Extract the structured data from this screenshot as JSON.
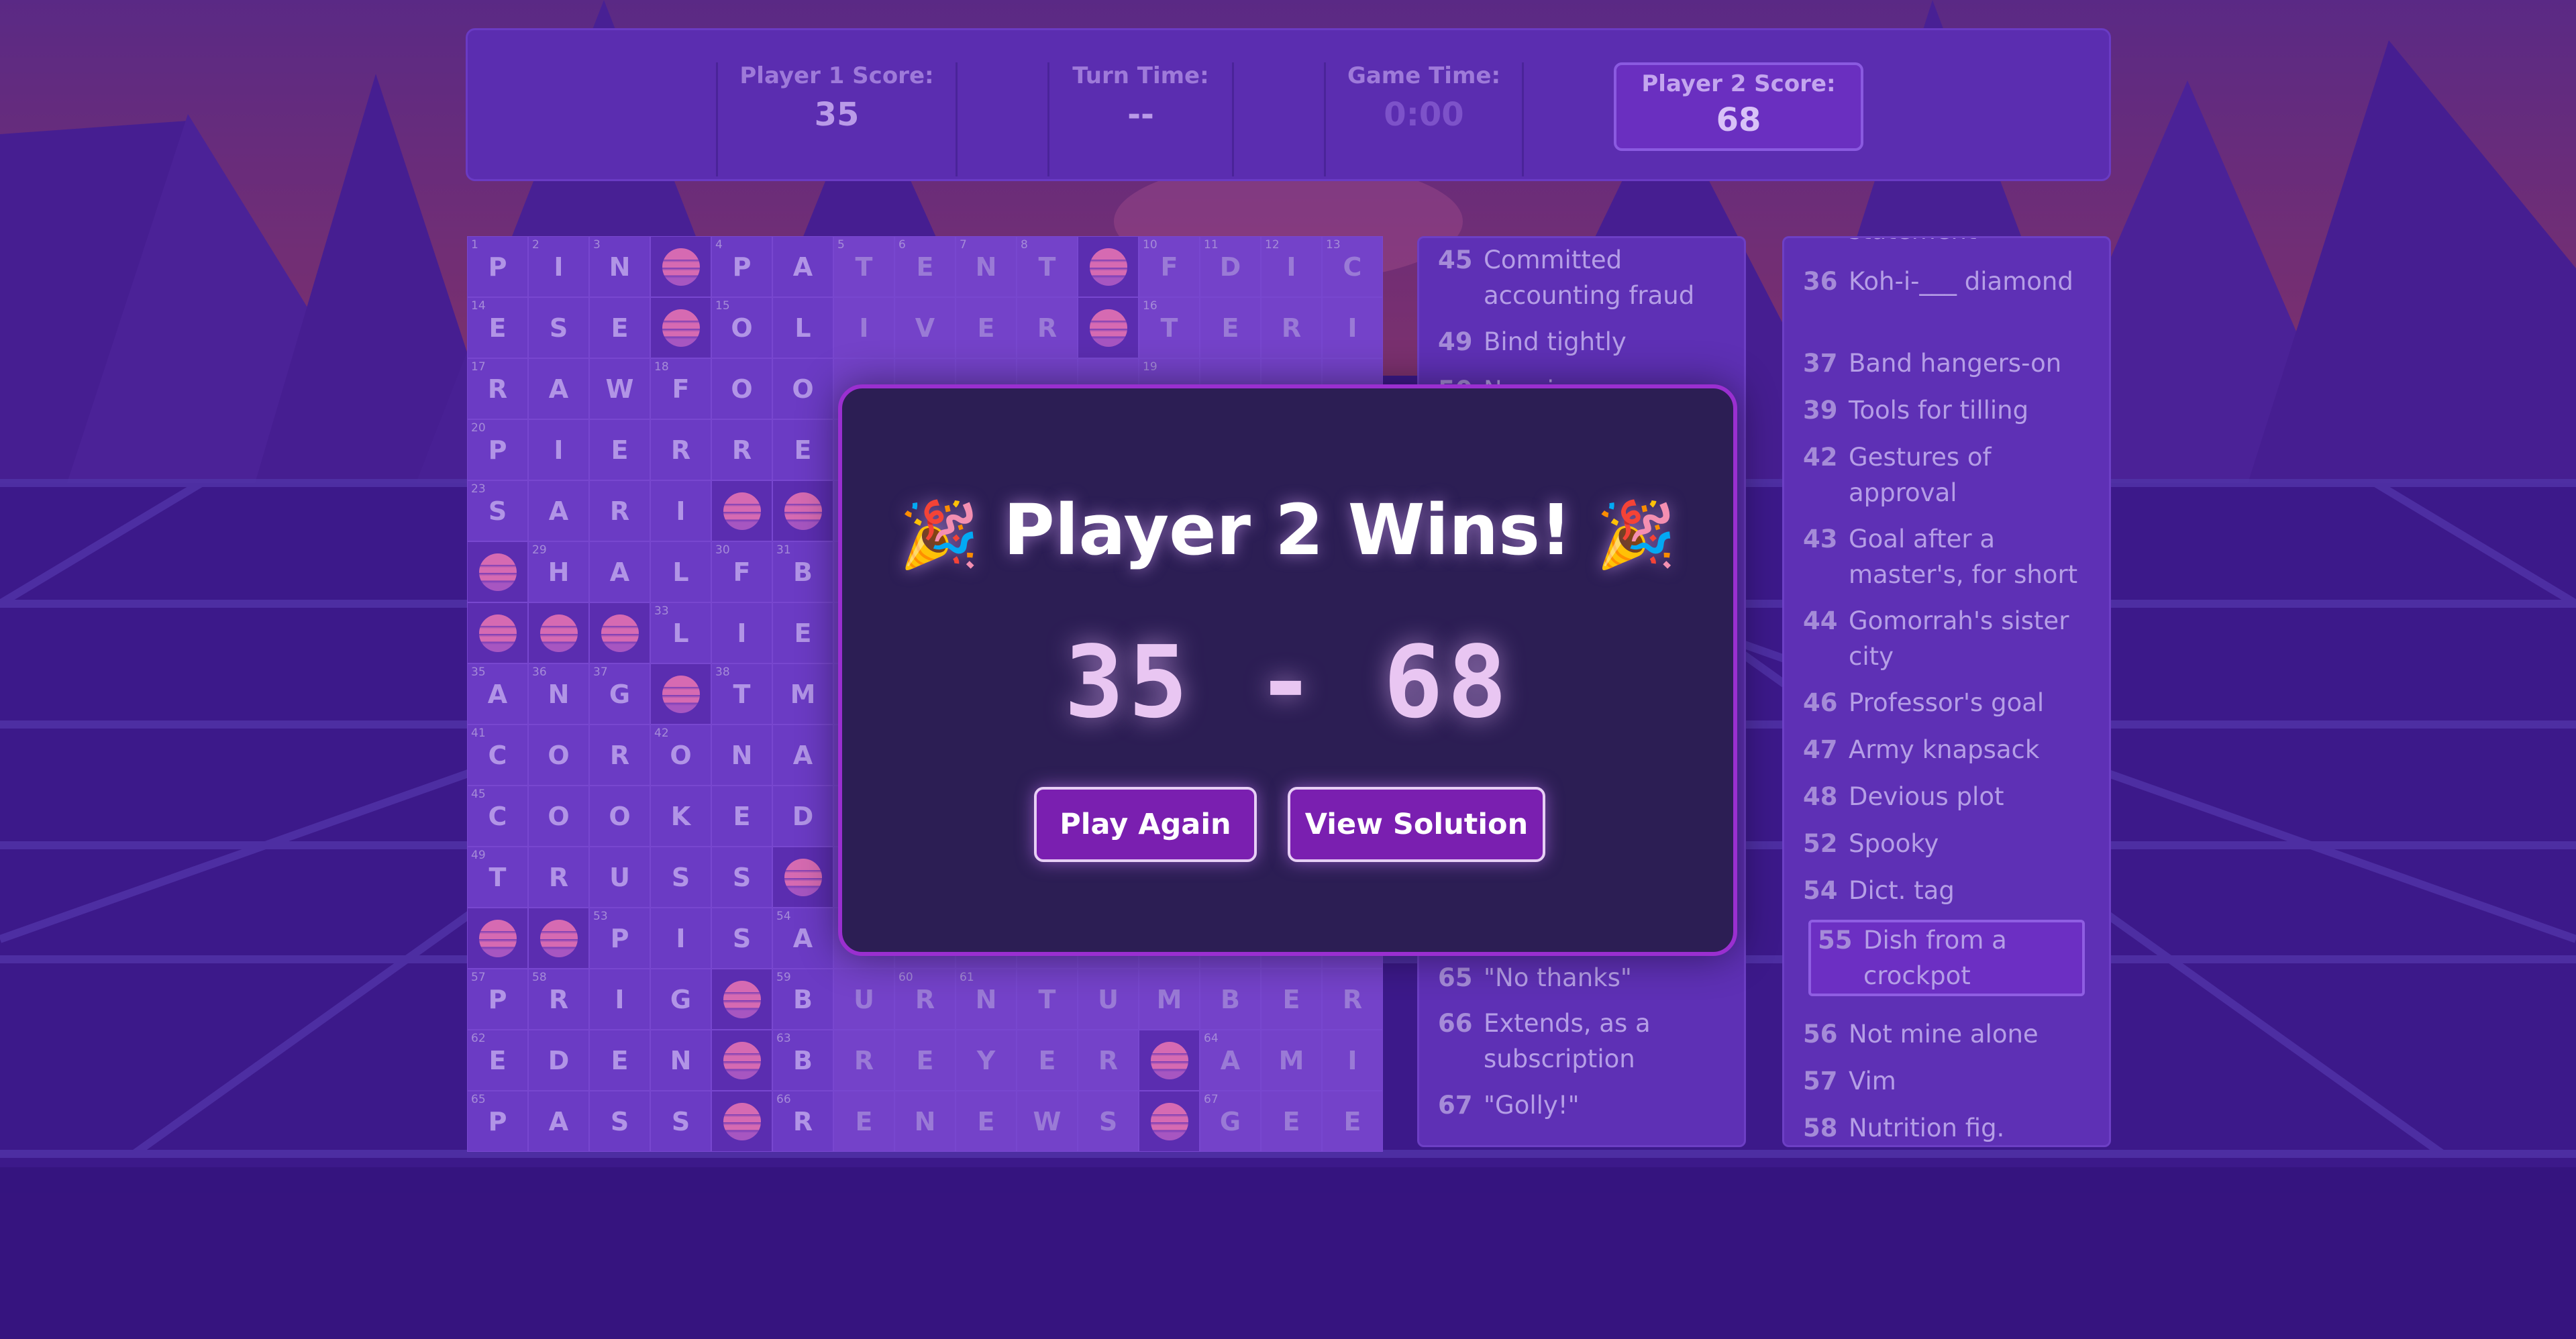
{
  "scoreboard": {
    "player1": {
      "label": "Player 1 Score:",
      "value": "35"
    },
    "turn_time": {
      "label": "Turn Time:",
      "value": "--"
    },
    "game_time": {
      "label": "Game Time:",
      "value": "0:00"
    },
    "player2": {
      "label": "Player 2 Score:",
      "value": "68"
    }
  },
  "grid": {
    "rows": [
      [
        "1:P",
        "2:I",
        "3:N",
        "#",
        "4:P",
        "A",
        "5:T",
        "6:E",
        "7:N",
        "8:T",
        "#",
        "10:F",
        "11:D",
        "12:I",
        "13:C"
      ],
      [
        "14:E",
        "S",
        "E",
        "#",
        "15:O",
        "L",
        "I",
        "V",
        "E",
        "R",
        "#",
        "16:T",
        "E",
        "R",
        "I"
      ],
      [
        "17:R",
        "A",
        "W",
        "18:F",
        "O",
        "O",
        "",
        "",
        "",
        "",
        "",
        "19:",
        "",
        "",
        ""
      ],
      [
        "20:P",
        "I",
        "E",
        "R",
        "R",
        "E",
        "",
        "",
        "",
        "",
        "",
        "",
        "",
        "",
        ""
      ],
      [
        "23:S",
        "A",
        "R",
        "I",
        "#",
        "#",
        "",
        "",
        "",
        "",
        "",
        "",
        "",
        "",
        ""
      ],
      [
        "#",
        "29:H",
        "A",
        "L",
        "30:F",
        "31:B",
        "",
        "",
        "",
        "",
        "",
        "",
        "",
        "",
        ""
      ],
      [
        "#",
        "#",
        "#",
        "33:L",
        "I",
        "E",
        "",
        "",
        "",
        "",
        "",
        "",
        "",
        "",
        ""
      ],
      [
        "35:A",
        "36:N",
        "37:G",
        "#",
        "38:T",
        "M",
        "",
        "",
        "",
        "",
        "",
        "",
        "",
        "",
        ""
      ],
      [
        "41:C",
        "O",
        "R",
        "42:O",
        "N",
        "A",
        "",
        "",
        "",
        "",
        "",
        "",
        "",
        "",
        ""
      ],
      [
        "45:C",
        "O",
        "O",
        "K",
        "E",
        "D",
        "",
        "",
        "",
        "",
        "",
        "",
        "",
        "",
        ""
      ],
      [
        "49:T",
        "R",
        "U",
        "S",
        "S",
        "#",
        "",
        "",
        "",
        "",
        "",
        "",
        "",
        "",
        ""
      ],
      [
        "#",
        "#",
        "53:P",
        "I",
        "S",
        "54:A",
        "",
        "",
        "",
        "",
        "",
        "",
        "",
        "",
        ""
      ],
      [
        "57:P",
        "58:R",
        "I",
        "G",
        "#",
        "59:B",
        "U",
        "60:R",
        "61:N",
        "T",
        "U",
        "M",
        "B",
        "E",
        "R"
      ],
      [
        "62:E",
        "D",
        "E",
        "N",
        "#",
        "63:B",
        "R",
        "E",
        "Y",
        "E",
        "R",
        "#",
        "64:A",
        "M",
        "I"
      ],
      [
        "65:P",
        "A",
        "S",
        "S",
        "#",
        "66:R",
        "E",
        "N",
        "E",
        "W",
        "S",
        "#",
        "67:G",
        "E",
        "E"
      ]
    ]
  },
  "clues_a": [
    {
      "num": "45",
      "text": "Committed accounting fraud"
    },
    {
      "num": "49",
      "text": "Bind tightly"
    },
    {
      "num": "50",
      "text": "No-win..."
    },
    {
      "num": "65",
      "text": "\"No thanks\""
    },
    {
      "num": "66",
      "text": "Extends, as a subscription"
    },
    {
      "num": "67",
      "text": "\"Golly!\""
    }
  ],
  "clues_b": [
    {
      "num": "",
      "text": "statement"
    },
    {
      "num": "36",
      "text": "Koh-i-___ diamond"
    },
    {
      "num": "37",
      "text": "Band hangers-on"
    },
    {
      "num": "39",
      "text": "Tools for tilling"
    },
    {
      "num": "42",
      "text": "Gestures of approval"
    },
    {
      "num": "43",
      "text": "Goal after a master's, for short"
    },
    {
      "num": "44",
      "text": "Gomorrah's sister city"
    },
    {
      "num": "46",
      "text": "Professor's goal"
    },
    {
      "num": "47",
      "text": "Army knapsack"
    },
    {
      "num": "48",
      "text": "Devious plot"
    },
    {
      "num": "52",
      "text": "Spooky"
    },
    {
      "num": "54",
      "text": "Dict. tag"
    },
    {
      "num": "55",
      "text": "Dish from a crockpot"
    },
    {
      "num": "56",
      "text": "Not mine alone"
    },
    {
      "num": "57",
      "text": "Vim"
    },
    {
      "num": "58",
      "text": "Nutrition fig."
    }
  ],
  "modal": {
    "title": "Player 2 Wins!",
    "confetti": "🎉",
    "final_score": "35 - 68",
    "play_again_label": "Play Again",
    "view_solution_label": "View Solution"
  },
  "colors": {
    "sky_top": "#7a3da0",
    "sky_bottom": "#b0487a",
    "mountain": "#5a2bb4",
    "floor": "#4a22a8",
    "grid_line": "#6a4bd6",
    "modal_border": "#9a2fd0",
    "button_bg": "#7a1fb0"
  }
}
